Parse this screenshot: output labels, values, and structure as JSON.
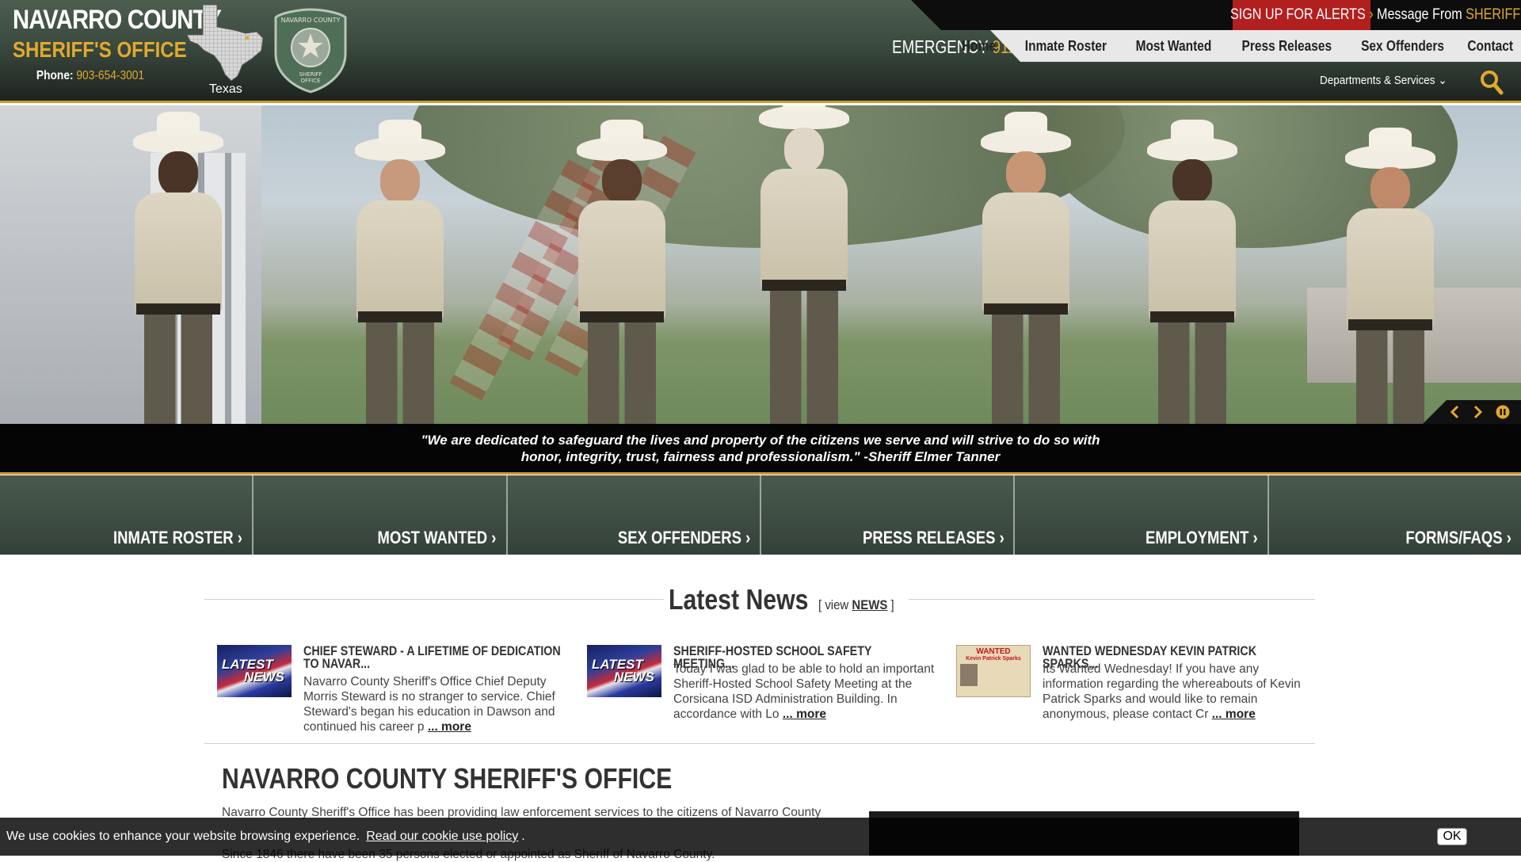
{
  "brand": {
    "county": "NAVARRO COUNTY",
    "office": "SHERIFF'S OFFICE",
    "phone_label": "Phone:",
    "phone_number": "903-654-3001",
    "state_label": "Texas"
  },
  "alerts": {
    "signup_label": "SIGN UP FOR ALERTS",
    "message_prefix": "Message From",
    "message_highlight": "SHERIFF"
  },
  "emergency": {
    "label": "EMERGENCY",
    "number": "911"
  },
  "nav": {
    "items": [
      "Home",
      "Inmate Roster",
      "Most Wanted",
      "Press Releases",
      "Sex Offenders",
      "Contact"
    ],
    "departments_label": "Departments & Services"
  },
  "hero": {
    "quote": "\"We are dedicated to safeguard the lives and property of the citizens we serve and will strive to do so with honor, integrity, trust, fairness and professionalism.\" -Sheriff Elmer Tanner"
  },
  "quick_links": [
    "INMATE ROSTER",
    "MOST WANTED",
    "SEX OFFENDERS",
    "PRESS RELEASES",
    "EMPLOYMENT",
    "FORMS/FAQS"
  ],
  "news": {
    "heading": "Latest News",
    "view_prefix": "[ view",
    "view_link": "NEWS",
    "view_suffix": "]",
    "items": [
      {
        "thumb_line1": "LATEST",
        "thumb_line2": "NEWS",
        "title": "CHIEF STEWARD - A LIFETIME OF DEDICATION TO NAVAR...",
        "body": "Navarro County Sheriff's Office Chief Deputy Morris Steward is no stranger to service. Chief Steward's began his education in Dawson and continued his career p",
        "more": "... more"
      },
      {
        "thumb_line1": "LATEST",
        "thumb_line2": "NEWS",
        "title": "SHERIFF-HOSTED SCHOOL SAFETY MEETING...",
        "body": "Today I was glad to be able to hold an important Sheriff-Hosted School Safety Meeting at the Corsicana ISD Administration Building. In accordance with Lo",
        "more": "... more"
      },
      {
        "thumb_line1": "WANTED",
        "thumb_line2": "Kevin Patrick Sparks",
        "title": "WANTED WEDNESDAY KEVIN PATRICK SPARKS...",
        "body": "Its Wanted Wednesday! If you have any information regarding the whereabouts of Kevin Patrick Sparks and would like to remain anonymous, please contact Cr",
        "more": "... more"
      }
    ]
  },
  "about": {
    "title": "NAVARRO COUNTY SHERIFF'S OFFICE",
    "paragraph1": "Navarro County Sheriff's Office has been providing law enforcement services to the citizens of Navarro County",
    "paragraph2": "Since 1846 there have been 35 persons elected or appointed as Sheriff of Navarro County."
  },
  "cookie": {
    "text": "We use cookies to enhance your website browsing experience.",
    "link": "Read our cookie use policy",
    "dot": ".",
    "ok": "OK"
  },
  "colors": {
    "gold": "#e2a92e",
    "alert_red": "#b21f1f",
    "header_green": "#3a4a3e"
  }
}
